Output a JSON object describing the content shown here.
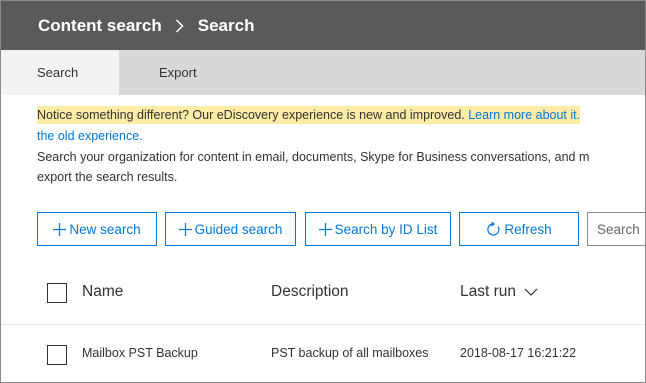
{
  "header": {
    "breadcrumb_root": "Content search",
    "breadcrumb_current": "Search"
  },
  "tabs": [
    {
      "label": "Search",
      "active": true
    },
    {
      "label": "Export",
      "active": false
    }
  ],
  "notice": {
    "text": "Notice something different? Our eDiscovery experience is new and improved. ",
    "link_line1": "Learn more about it.",
    "link_line2": "the old experience."
  },
  "description": {
    "line1": "Search your organization for content in email, documents, Skype for Business conversations, and m",
    "line2": "export the search results."
  },
  "toolbar": {
    "new_search": "New search",
    "guided_search": "Guided search",
    "search_by_id": "Search by ID List",
    "refresh": "Refresh",
    "search_placeholder": "Search"
  },
  "table": {
    "columns": [
      "Name",
      "Description",
      "Last run"
    ],
    "rows": [
      {
        "name": "Mailbox PST Backup",
        "description": "PST backup of all mailboxes",
        "last_run": "2018-08-17 16:21:22"
      }
    ]
  },
  "colors": {
    "header_bg": "#5a5a5a",
    "tabs_bg": "#d8d8d8",
    "active_tab_bg": "#f3f3f3",
    "accent": "#0078d7",
    "notice_highlight": "#fdeca6"
  },
  "icons": {
    "breadcrumb_separator": "chevron-right-icon",
    "add": "plus-icon",
    "refresh": "refresh-icon",
    "sort": "chevron-down-icon"
  }
}
